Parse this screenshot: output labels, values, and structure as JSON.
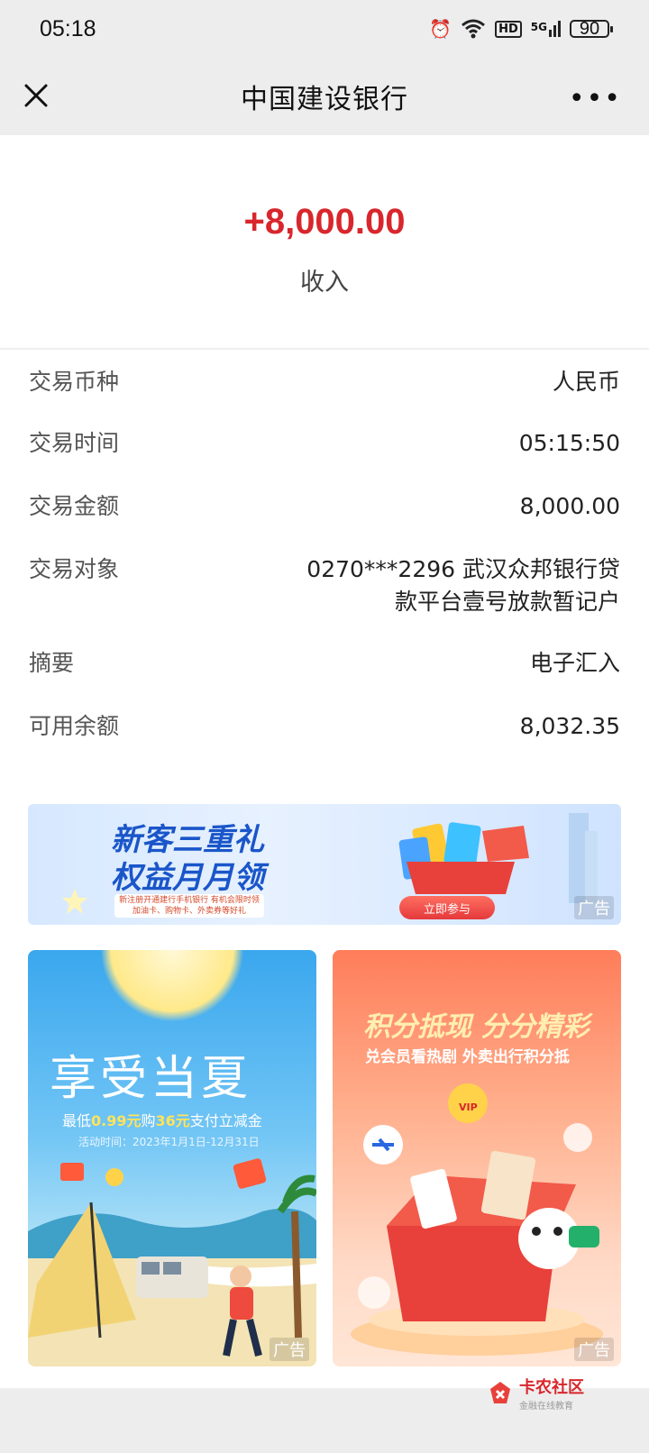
{
  "status_bar": {
    "time": "05:18",
    "network": "5G",
    "hd": "HD",
    "battery": "90"
  },
  "header": {
    "title": "中国建设银行",
    "more": "•••"
  },
  "summary": {
    "amount": "+8,000.00",
    "type": "收入"
  },
  "details": [
    {
      "label": "交易币种",
      "value": "人民币"
    },
    {
      "label": "交易时间",
      "value": "05:15:50"
    },
    {
      "label": "交易金额",
      "value": "8,000.00"
    },
    {
      "label": "交易对象",
      "value_lines": [
        "0270***2296 武汉众邦银行贷",
        "款平台壹号放款暂记户"
      ]
    },
    {
      "label": "摘要",
      "value": "电子汇入"
    },
    {
      "label": "可用余额",
      "value": "8,032.35"
    }
  ],
  "ads": {
    "tag": "广告",
    "banner": {
      "line1": "新客三重礼",
      "line2": "权益月月领",
      "small": "新注册开通建行手机银行 有机会限时领加油卡、购物卡、外卖券等好礼",
      "button": "立即参与"
    },
    "left": {
      "title": "享受当夏",
      "subtitle_prefix": "最低",
      "subtitle_price": "0.99元",
      "subtitle_mid": "购",
      "subtitle_value": "36元",
      "subtitle_suffix": "支付立减金",
      "period": "活动时间：2023年1月1日-12月31日"
    },
    "right": {
      "title": "积分抵现 分分精彩",
      "subtitle": "兑会员看热剧 外卖出行积分抵",
      "vip": "VIP"
    }
  },
  "watermark": {
    "name": "卡农社区",
    "sub": "金融在线教育"
  }
}
